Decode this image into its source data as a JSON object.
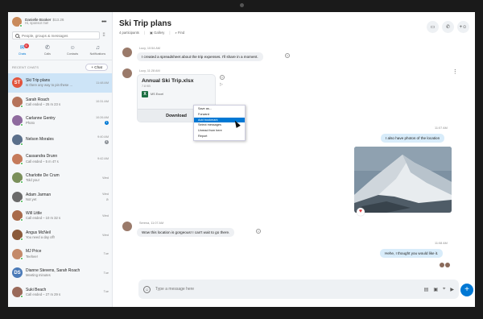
{
  "profile": {
    "name": "Danielle Booker",
    "balance": "$13.26",
    "mood": "Hi, sponsor me!"
  },
  "search": {
    "placeholder": "People, groups & messages"
  },
  "nav": [
    {
      "label": "Chats",
      "icon": "chat-icon",
      "badge": "6"
    },
    {
      "label": "Calls",
      "icon": "phone-icon"
    },
    {
      "label": "Contacts",
      "icon": "contacts-icon"
    },
    {
      "label": "Notifications",
      "icon": "bell-icon"
    }
  ],
  "recent": {
    "label": "RECENT CHATS",
    "chat_button": "+ Chat"
  },
  "chats": [
    {
      "name": "Ski Trip plans",
      "preview": "Is there any way to pin these ...",
      "time": "11:48 AM",
      "initials": "ST",
      "color": "#e2543d",
      "selected": true
    },
    {
      "name": "Sarah Roach",
      "preview": "Call ended – 25 m 23 s",
      "time": "10:31 AM",
      "color": "#b5735a"
    },
    {
      "name": "Carlanne Gentry",
      "preview": "Photo",
      "time": "10:26 AM",
      "color": "#8e6a9e",
      "badge": "1"
    },
    {
      "name": "Nelson Morales",
      "preview": "",
      "time": "9:40 AM",
      "color": "#5a6f8a",
      "badge": "4",
      "badge_grey": true
    },
    {
      "name": "Cassandra Drunn",
      "preview": "Call ended – 5 m 47 s",
      "time": "9:42 AM",
      "color": "#c57a5a"
    },
    {
      "name": "Charlotte De Crum",
      "preview": "Told you!",
      "time": "Wed",
      "color": "#7a8f5a"
    },
    {
      "name": "Adam Jarman",
      "preview": "Not yet",
      "time": "Wed",
      "color": "#6a6a6a",
      "mute": "⊘"
    },
    {
      "name": "Will Little",
      "preview": "Call ended – 10 m 32 s",
      "time": "Wed",
      "color": "#a86a4a"
    },
    {
      "name": "Angus McNeil",
      "preview": "You need a day off!",
      "time": "Wed",
      "color": "#8a5a3a"
    },
    {
      "name": "MJ Price",
      "preview": "Teehee!",
      "time": "Tue",
      "color": "#c48a6a"
    },
    {
      "name": "Dianne Stevens, Sarah Roach",
      "preview": "Meeting minutes",
      "time": "Tue",
      "initials": "DS",
      "color": "#4a7ab8"
    },
    {
      "name": "Suki Beach",
      "preview": "Call ended – 27 m 29 s",
      "time": "Tue",
      "color": "#9a6a5a"
    }
  ],
  "conversation": {
    "title": "Ski Trip plans",
    "participants": "4 participants",
    "gallery": "Gallery",
    "find": "Find",
    "messages": {
      "m1_meta": "Lucy, 10:54 AM",
      "m1_text": "I created a spreadsheet about the trip expenses. I'll share in a moment.",
      "m2_meta": "Lucy, 11:28 AM",
      "file_name": "Annual Ski Trip.xlsx",
      "file_size": "7.8 KB",
      "file_type": "MS Excel",
      "file_download": "Download",
      "m3_time": "11:07 AM",
      "m3_text": "I also have photos of the location",
      "m4_meta": "Serena, 11:07 AM",
      "m4_text": "Wow this location is gorgeous! I can't wait to go there.",
      "m5_time": "11:08 AM",
      "m5_text": "Hehe, I thought you would like it."
    }
  },
  "context_menu": [
    "Save as...",
    "Forward",
    "Add bookmark",
    "Select messages",
    "Unread from here",
    "Report"
  ],
  "composer": {
    "placeholder": "Type a message here"
  },
  "colors": {
    "accent": "#0078d4",
    "selected": "#cde4f7",
    "bubble_mine": "#d8ecfa",
    "bubble_other": "#eef0f3"
  }
}
